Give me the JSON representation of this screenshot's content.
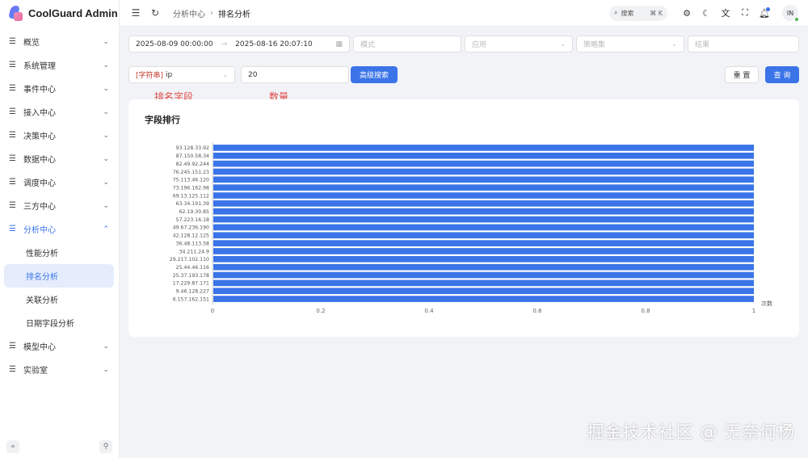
{
  "app": {
    "title": "CoolGuard Admin"
  },
  "sidebar": {
    "items": [
      {
        "label": "概览"
      },
      {
        "label": "系统管理"
      },
      {
        "label": "事件中心"
      },
      {
        "label": "接入中心"
      },
      {
        "label": "决策中心"
      },
      {
        "label": "数据中心"
      },
      {
        "label": "调度中心"
      },
      {
        "label": "三方中心"
      },
      {
        "label": "分析中心"
      },
      {
        "label": "模型中心"
      },
      {
        "label": "实验室"
      }
    ],
    "sub_items": [
      {
        "label": "性能分析"
      },
      {
        "label": "排名分析"
      },
      {
        "label": "关联分析"
      },
      {
        "label": "日期字段分析"
      }
    ],
    "collapse_icon": "«",
    "pin_icon": "⚲"
  },
  "header": {
    "breadcrumb": [
      "分析中心",
      "排名分析"
    ],
    "search_label": "搜索",
    "search_shortcut": "⌘ K",
    "avatar": "IN"
  },
  "filters": {
    "start_time": "2025-08-09 00:00:00",
    "end_time": "2025-08-16 20:07:10",
    "mode_placeholder": "模式",
    "app_placeholder": "应用",
    "policy_placeholder": "策略集",
    "result_placeholder": "结果",
    "field_tag": "[字符串]",
    "field_value": "ip",
    "count_value": "20",
    "advanced_search": "高级搜索",
    "reset": "重 置",
    "query": "查 询"
  },
  "annotations": {
    "field": "排名字段",
    "count": "数量"
  },
  "card": {
    "title": "字段排行"
  },
  "watermark": "掘金技术社区 @ 无奈何杨",
  "colors": {
    "primary": "#3b74e8",
    "bar": "#3b74e8",
    "annotation": "#e04848"
  },
  "chart_data": {
    "type": "bar",
    "orientation": "horizontal",
    "categories": [
      "93.128.33.92",
      "87.150.58.34",
      "82.49.92.244",
      "76.245.151.23",
      "75.113.46.120",
      "73.196.162.98",
      "69.13.125.112",
      "63.34.191.39",
      "62.19.30.85",
      "57.223.16.18",
      "49.67.236.190",
      "42.128.12.125",
      "36.48.113.58",
      "34.211.24.9",
      "29.217.102.110",
      "25.44.46.116",
      "25.37.193.178",
      "17.229.87.171",
      "9.46.128.227",
      "6.157.162.151"
    ],
    "values": [
      1,
      1,
      1,
      1,
      1,
      1,
      1,
      1,
      1,
      1,
      1,
      1,
      1,
      1,
      1,
      1,
      1,
      1,
      1,
      1
    ],
    "xlabel": "次数",
    "xlim": [
      0,
      1
    ],
    "xticks": [
      "0",
      "0.2",
      "0.4",
      "0.6",
      "0.8",
      "1"
    ],
    "grid": false
  }
}
